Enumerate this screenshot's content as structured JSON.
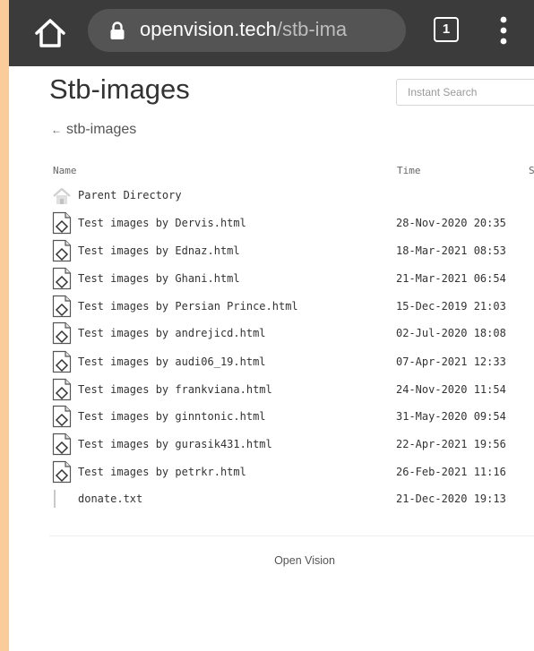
{
  "browser": {
    "url_domain": "openvision.tech",
    "url_path": "/stb-ima",
    "tab_count": "1",
    "icons": [
      "home-icon",
      "lock-icon",
      "tabs-icon",
      "overflow-menu-icon"
    ]
  },
  "page": {
    "title": "Stb-images",
    "search_placeholder": "Instant Search",
    "breadcrumb_arrow": "←",
    "breadcrumb_label": "stb-images"
  },
  "table": {
    "headers": {
      "name": "Name",
      "time": "Time",
      "size": "S"
    },
    "rows": [
      {
        "name": "Parent Directory",
        "time": "",
        "icon": "parent-directory-icon"
      },
      {
        "name": "Test images by Dervis.html",
        "time": "28-Nov-2020 20:35",
        "icon": "html-file-icon"
      },
      {
        "name": "Test images by Ednaz.html",
        "time": "18-Mar-2021 08:53",
        "icon": "html-file-icon"
      },
      {
        "name": "Test images by Ghani.html",
        "time": "21-Mar-2021 06:54",
        "icon": "html-file-icon"
      },
      {
        "name": "Test images by Persian Prince.html",
        "time": "15-Dec-2019 21:03",
        "icon": "html-file-icon"
      },
      {
        "name": "Test images by andrejicd.html",
        "time": "02-Jul-2020 18:08",
        "icon": "html-file-icon"
      },
      {
        "name": "Test images by audi06_19.html",
        "time": "07-Apr-2021 12:33",
        "icon": "html-file-icon"
      },
      {
        "name": "Test images by frankviana.html",
        "time": "24-Nov-2020 11:54",
        "icon": "html-file-icon"
      },
      {
        "name": "Test images by ginntonic.html",
        "time": "31-May-2020 09:54",
        "icon": "html-file-icon"
      },
      {
        "name": "Test images by gurasik431.html",
        "time": "22-Apr-2021 19:56",
        "icon": "html-file-icon"
      },
      {
        "name": "Test images by petrkr.html",
        "time": "26-Feb-2021 11:16",
        "icon": "html-file-icon"
      },
      {
        "name": "donate.txt",
        "time": "21-Dec-2020 19:13",
        "icon": "text-file-icon"
      }
    ]
  },
  "footer": {
    "text": "Open Vision"
  },
  "colors": {
    "page_border": "#f9cc9c",
    "browser_bar": "#3b3b3b",
    "url_pill": "#545454",
    "text": "#333333"
  }
}
